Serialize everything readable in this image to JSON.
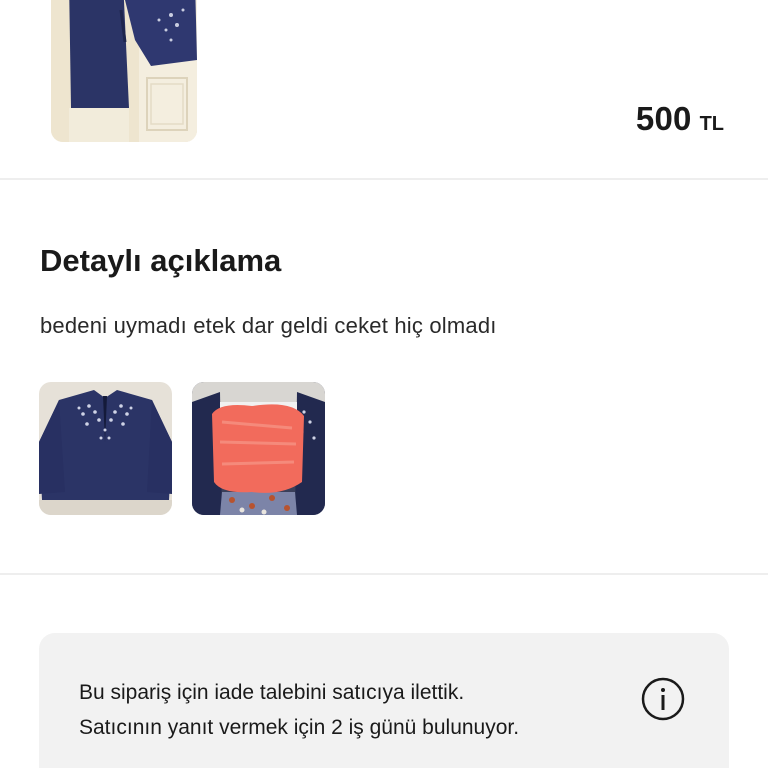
{
  "product": {
    "price_amount": "500",
    "price_currency": "TL",
    "image_icon": "product-photo"
  },
  "description": {
    "title": "Detaylı açıklama",
    "text": "bedeni uymadı etek dar geldi ceket hiç olmadı",
    "photos": [
      {
        "icon": "jacket-photo"
      },
      {
        "icon": "worn-jacket-photo"
      }
    ]
  },
  "info_box": {
    "line1": "Bu sipariş için iade talebini satıcıya ilettik.",
    "line2": "Satıcının yanıt vermek için 2 iş günü bulunuyor.",
    "icon": "info-icon"
  },
  "colors": {
    "navy": "#2b3466",
    "info_bg": "#f2f2f2",
    "divider": "#eeeeee"
  }
}
